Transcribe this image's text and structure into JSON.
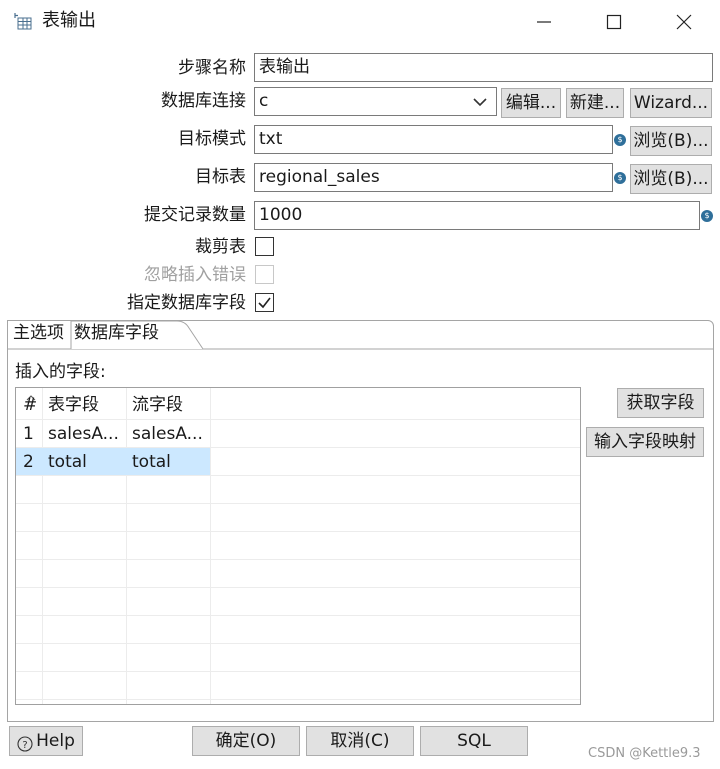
{
  "window": {
    "title": "表输出"
  },
  "form": {
    "step_name": {
      "label": "步骤名称",
      "value": "表输出"
    },
    "connection": {
      "label": "数据库连接",
      "value": "c",
      "edit_label": "编辑...",
      "new_label": "新建...",
      "wizard_label": "Wizard..."
    },
    "target_schema": {
      "label": "目标模式",
      "value": "txt",
      "browse_label": "浏览(B)..."
    },
    "target_table": {
      "label": "目标表",
      "value": "regional_sales",
      "browse_label": "浏览(B)..."
    },
    "commit_size": {
      "label": "提交记录数量",
      "value": "1000"
    },
    "truncate": {
      "label": "裁剪表",
      "checked": false
    },
    "ignore_errors": {
      "label": "忽略插入错误",
      "checked": false,
      "disabled": true
    },
    "specify_fields": {
      "label": "指定数据库字段",
      "checked": true
    }
  },
  "tabs": [
    {
      "label": "主选项",
      "active": false
    },
    {
      "label": "数据库字段",
      "active": true
    }
  ],
  "fields_panel": {
    "caption": "插入的字段:",
    "get_fields_label": "获取字段",
    "mapping_label": "输入字段映射",
    "columns": [
      "#",
      "表字段",
      "流字段"
    ],
    "rows": [
      {
        "num": "1",
        "table_field": "salesA...",
        "stream_field": "salesA...",
        "selected": false
      },
      {
        "num": "2",
        "table_field": "total",
        "stream_field": "total",
        "selected": true
      }
    ]
  },
  "footer": {
    "help_label": "Help",
    "ok_label": "确定(O)",
    "cancel_label": "取消(C)",
    "sql_label": "SQL",
    "watermark": "CSDN @Kettle9.3"
  },
  "icons": {
    "app": "table-output-icon",
    "variable": "variable-dollar-icon",
    "help": "question-circle-icon"
  },
  "colors": {
    "selected_row": "#cce8ff",
    "button_bg": "#e1e1e1",
    "border": "#7a7a7a"
  }
}
